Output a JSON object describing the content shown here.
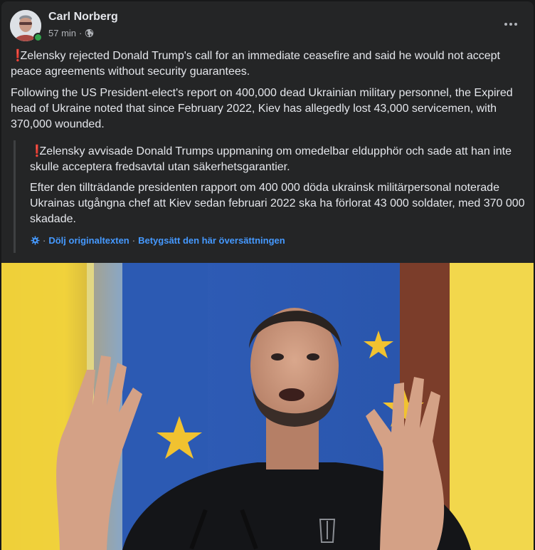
{
  "post": {
    "author": "Carl Norberg",
    "time": "57 min",
    "dot": "·",
    "paragraph1": "Zelensky rejected Donald Trump's call for an immediate ceasefire and said he would not accept peace agreements without security guarantees.",
    "paragraph2": "Following the US President-elect's report on 400,000 dead Ukrainian military personnel, the Expired head of Ukraine noted that since February 2022, Kiev has allegedly lost 43,000 servicemen, with 370,000 wounded.",
    "exclamation": "❗",
    "audience_icon": "globe-icon"
  },
  "original": {
    "paragraph1": "Zelensky avvisade Donald Trumps uppmaning om omedelbar eldupphör och sade att han inte skulle acceptera fredsavtal utan säkerhetsgarantier.",
    "paragraph2": "Efter den tillträdande presidenten rapport om 400 000 döda ukrainsk militärpersonal noterade Ukrainas utgångna chef att Kiev sedan februari 2022 ska ha förlorat 43 000 soldater, med 370 000 skadade.",
    "separator": "·",
    "hide_original_label": "Dölj originaltexten",
    "rate_translation_label": "Betygsätt den här översättningen",
    "settings_icon": "gear-icon"
  },
  "colors": {
    "card_bg": "#242526",
    "text_primary": "#e4e6eb",
    "text_secondary": "#b0b3b8",
    "link": "#4599ff",
    "online": "#31a24c",
    "alert": "#e0323e"
  }
}
